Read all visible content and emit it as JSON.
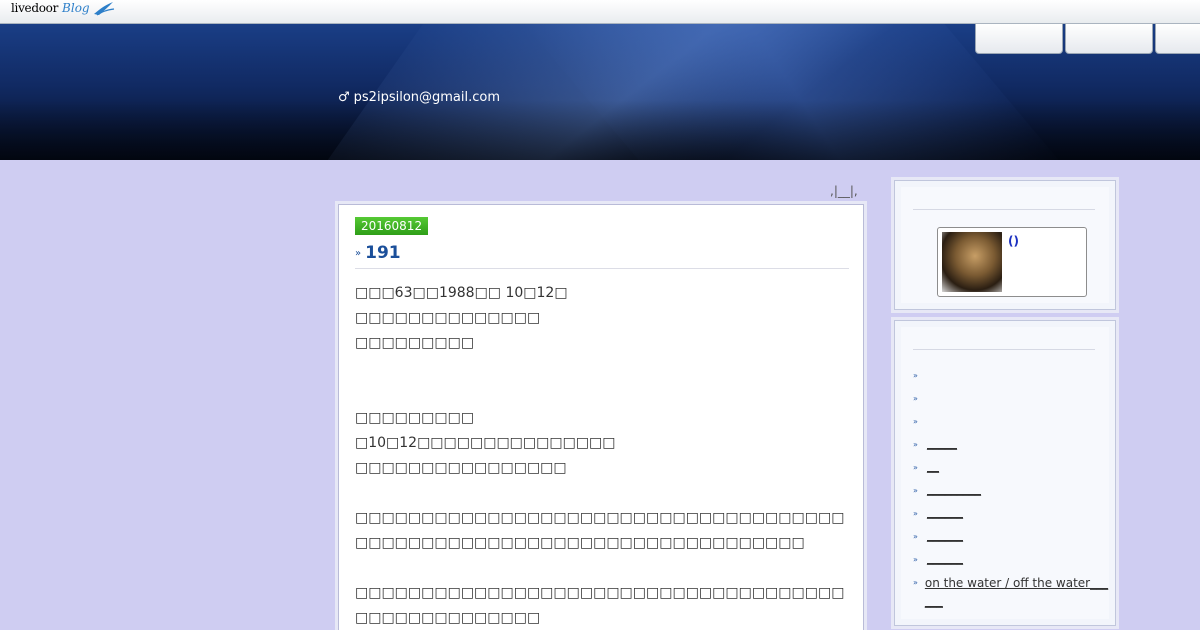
{
  "topbar": {
    "logo_main": "livedoor",
    "logo_sub": "Blog"
  },
  "header": {
    "email": "ps2ipsilon@gmail.com",
    "gender_icon": "♂",
    "tabs": [
      "",
      "",
      ""
    ]
  },
  "breadcrumb": ",|__|,",
  "article": {
    "date": "20160812",
    "title": "191",
    "paragraphs": [
      "□□□63□□1988□□ 10□12□",
      "□□□□□□□□□□□□□□",
      "□□□□□□□□□",
      " ",
      " ",
      "□□□□□□□□□",
      "□10□12□□□□□□□□□□□□□□□",
      "□□□□□□□□□□□□□□□□",
      " ",
      "□□□□□□□□□□□□□□□□□□□□□□□□□□□□□□□□□□□□□□□□□□□□□□□□□□□□□□□□□□□□□□□□□□□□□□□",
      " ",
      "□□□□□□□□□□□□□□□□□□□□□□□□□□□□□□□□□□□□□□□□□□□□□□□□□□□"
    ]
  },
  "sidebar": {
    "profile_link": "()",
    "links": [
      "",
      "",
      "",
      "_____",
      "__",
      "_________",
      "______",
      "______",
      "______",
      " on the water / off the water______"
    ]
  },
  "colors": {
    "accent": "#1b4f9a",
    "date_badge": "#3fb324",
    "page_bg": "#cfcdf2"
  }
}
